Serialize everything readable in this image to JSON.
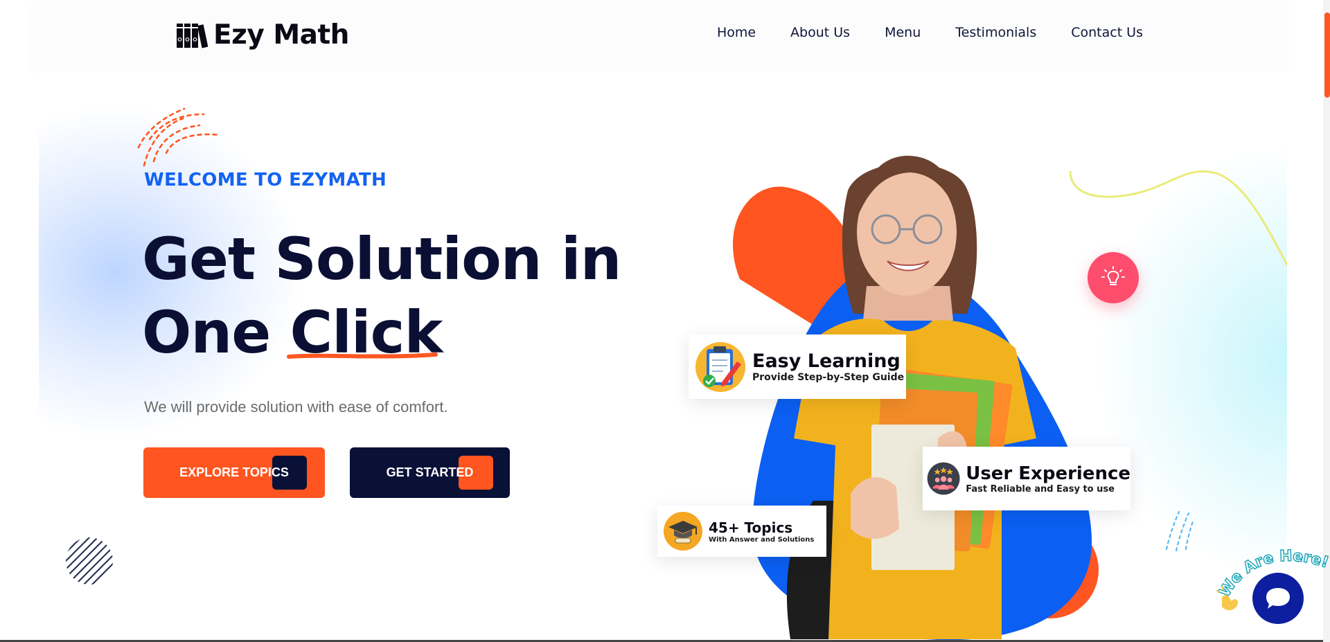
{
  "brand": {
    "name": "Ezy Math"
  },
  "nav": {
    "items": [
      {
        "label": "Home"
      },
      {
        "label": "About Us"
      },
      {
        "label": "Menu"
      },
      {
        "label": "Testimonials"
      },
      {
        "label": "Contact Us"
      }
    ]
  },
  "hero": {
    "eyebrow": "WELCOME TO EZYMATH",
    "headline_line1": "Get Solution in",
    "headline_line2_prefix": "One ",
    "headline_line2_highlight": "Click",
    "subtitle": "We will provide solution with ease of comfort.",
    "explore_button": "EXPLORE TOPICS",
    "started_button": "GET STARTED"
  },
  "cards": {
    "easy_learning": {
      "title": "Easy Learning",
      "subtitle": "Provide Step-by-Step Guide"
    },
    "user_experience": {
      "title": "User Experience",
      "subtitle": "Fast Reliable and Easy to use"
    },
    "topics": {
      "title": "45+ Topics",
      "subtitle": "With Answer and Solutions"
    }
  },
  "chat": {
    "tagline": "We Are Here!"
  },
  "colors": {
    "accent_orange": "#ff5520",
    "navy": "#0a1137",
    "eyebrow_blue": "#1363f2",
    "bulb_pink": "#ff4d6d",
    "blob_blue": "#0b5ff2",
    "shirt_yellow": "#f2b21e"
  },
  "icons": {
    "logo": "books-icon",
    "bulb": "lightbulb-icon",
    "easy_learning": "clipboard-pencil-icon",
    "user_experience": "users-rating-icon",
    "topics": "graduation-cap-icon",
    "chat": "chat-bubble-icon",
    "wave": "waving-hand-icon"
  }
}
